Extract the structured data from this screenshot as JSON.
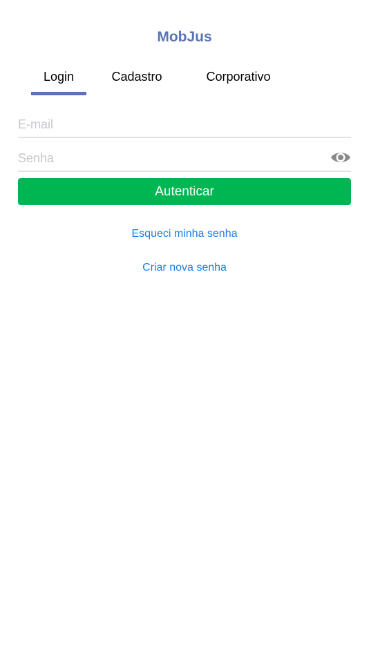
{
  "app": {
    "title": "MobJus"
  },
  "tabs": [
    {
      "label": "Login",
      "active": true
    },
    {
      "label": "Cadastro",
      "active": false
    },
    {
      "label": "Corporativo",
      "active": false
    }
  ],
  "form": {
    "email": {
      "value": "",
      "placeholder": "E-mail"
    },
    "password": {
      "value": "",
      "placeholder": "Senha",
      "toggle_icon": "eye-icon"
    },
    "submit_label": "Autenticar"
  },
  "links": {
    "forgot_password": "Esqueci minha senha",
    "create_password": "Criar nova senha"
  },
  "colors": {
    "brand": "#5a73b8",
    "primary_button": "#00b652",
    "link": "#1a7fe6",
    "placeholder": "#c7c7cd"
  }
}
